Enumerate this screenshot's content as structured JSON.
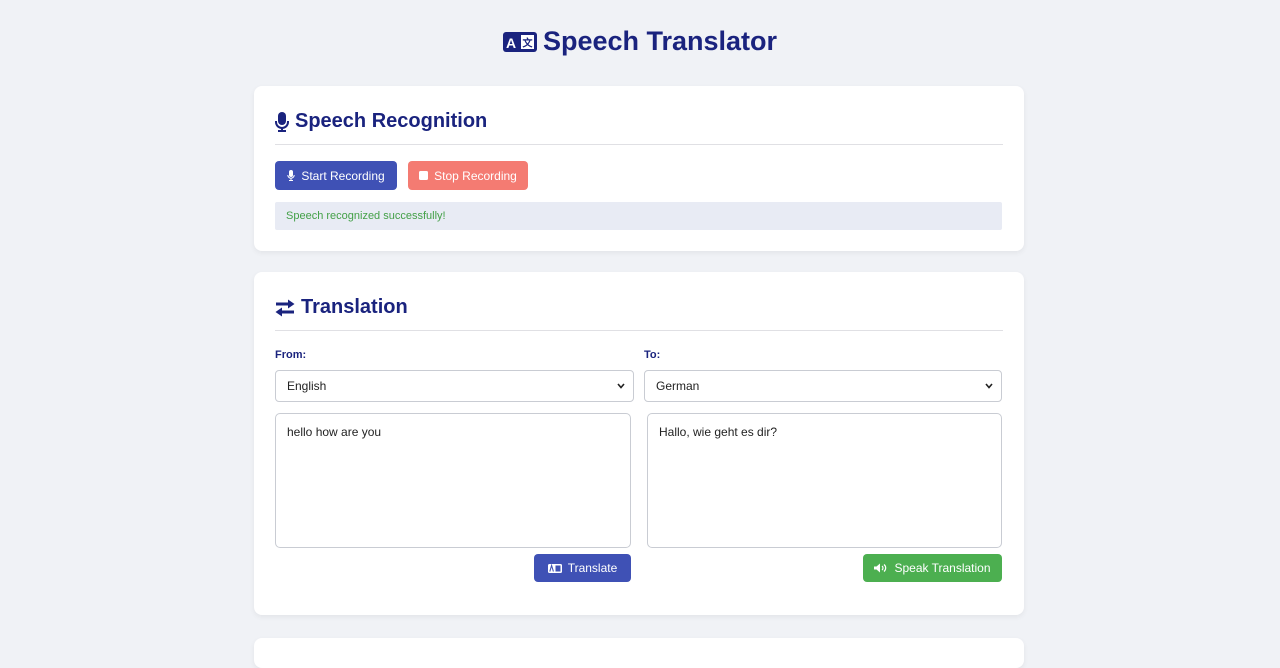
{
  "app": {
    "title": "Speech Translator"
  },
  "recognition": {
    "title": "Speech Recognition",
    "start_label": "Start Recording",
    "stop_label": "Stop Recording",
    "status_text": "Speech recognized successfully!"
  },
  "translation": {
    "title": "Translation",
    "from_label": "From:",
    "to_label": "To:",
    "from_language": "English",
    "to_language": "German",
    "source_text": "hello how are you",
    "translated_text": "Hallo, wie geht es dir?",
    "translate_label": "Translate",
    "speak_label": "Speak Translation"
  },
  "colors": {
    "primary": "#3f51b5",
    "heading": "#1a237e",
    "stop": "#f47b72",
    "success": "#4caf50",
    "status_text": "#43a047"
  },
  "icons": {
    "title": "translate-icon",
    "recognition": "microphone-icon",
    "translation": "exchange-arrows-icon",
    "speak": "volume-icon"
  }
}
